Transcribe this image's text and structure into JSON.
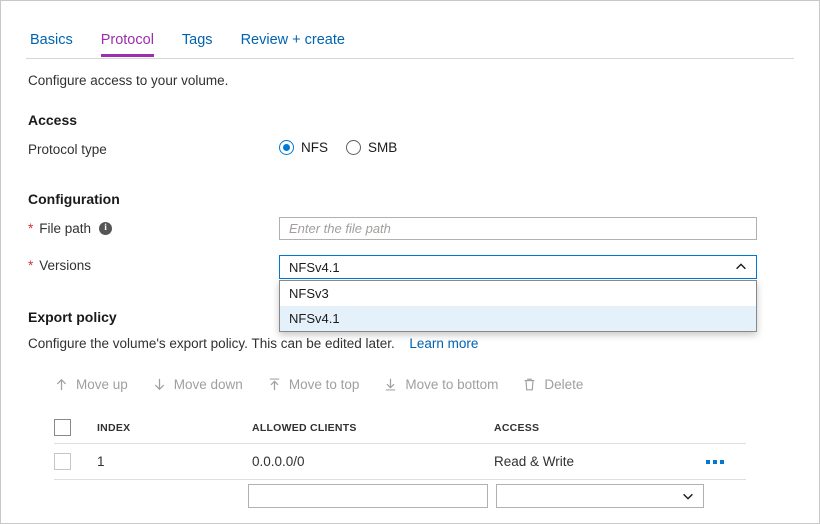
{
  "tabs": [
    {
      "label": "Basics",
      "active": false
    },
    {
      "label": "Protocol",
      "active": true
    },
    {
      "label": "Tags",
      "active": false
    },
    {
      "label": "Review + create",
      "active": false
    }
  ],
  "intro": "Configure access to your volume.",
  "access": {
    "heading": "Access",
    "protocol_type_label": "Protocol type",
    "options": [
      {
        "label": "NFS",
        "selected": true
      },
      {
        "label": "SMB",
        "selected": false
      }
    ]
  },
  "configuration": {
    "heading": "Configuration",
    "file_path": {
      "required_mark": "*",
      "label": "File path",
      "info_icon": "info-icon",
      "info_glyph": "i",
      "placeholder": "Enter the file path",
      "value": ""
    },
    "versions": {
      "required_mark": "*",
      "label": "Versions",
      "value": "NFSv4.1",
      "expanded": true,
      "caret_icon": "chevron-up-icon",
      "options": [
        {
          "label": "NFSv3",
          "selected": false
        },
        {
          "label": "NFSv4.1",
          "selected": true
        }
      ]
    }
  },
  "export_policy": {
    "heading": "Export policy",
    "description": "Configure the volume's export policy. This can be edited later.",
    "learn_more": "Learn more",
    "commands": [
      {
        "label": "Move up",
        "icon": "arrow-up-icon",
        "disabled": true
      },
      {
        "label": "Move down",
        "icon": "arrow-down-icon",
        "disabled": true
      },
      {
        "label": "Move to top",
        "icon": "arrow-to-top-icon",
        "disabled": true
      },
      {
        "label": "Move to bottom",
        "icon": "arrow-to-bottom-icon",
        "disabled": true
      },
      {
        "label": "Delete",
        "icon": "trash-icon",
        "disabled": true
      }
    ],
    "table": {
      "columns": [
        "INDEX",
        "ALLOWED CLIENTS",
        "ACCESS"
      ],
      "rows": [
        {
          "index": "1",
          "allowed_clients": "0.0.0.0/0",
          "access": "Read & Write",
          "more_icon": "ellipsis-icon"
        }
      ]
    },
    "new_row": {
      "allowed_clients_value": "",
      "allowed_clients_placeholder": "",
      "access_value": "",
      "access_caret_icon": "chevron-down-icon"
    }
  },
  "colors": {
    "accent_blue": "#0078d4",
    "link_blue": "#0063b1",
    "active_tab_purple": "#9b2fae",
    "required_red": "#d13438",
    "selected_row_bg": "#e4f1fb"
  }
}
